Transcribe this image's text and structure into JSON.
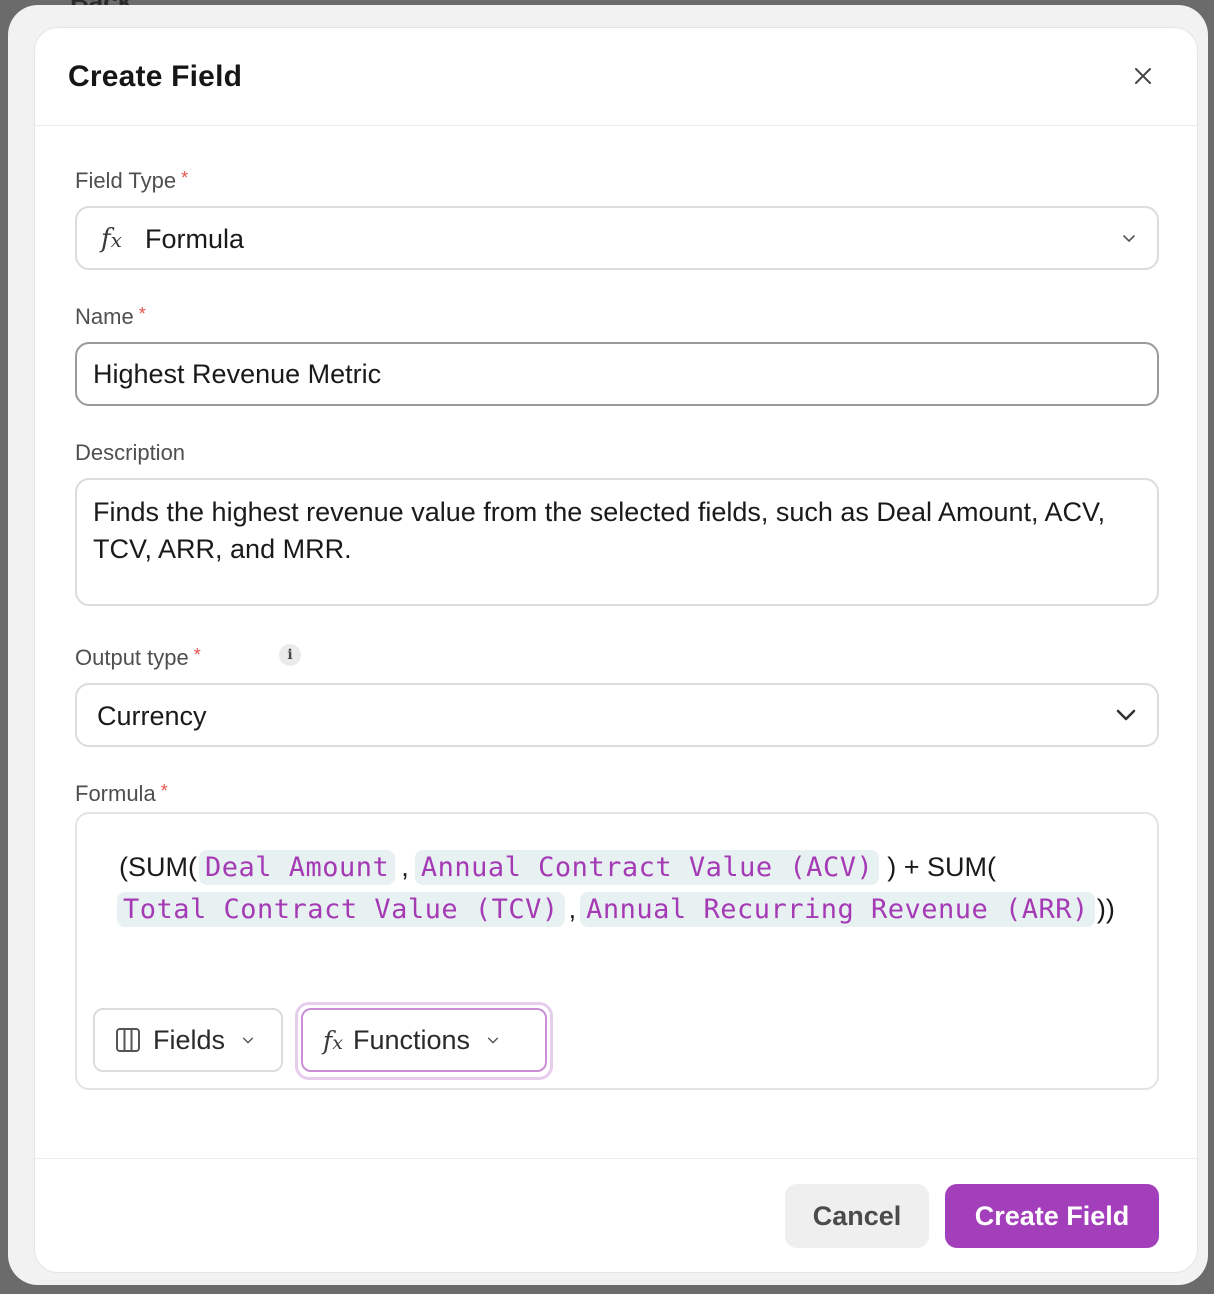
{
  "backdrop": {
    "text": "Back"
  },
  "modal": {
    "title": "Create Field",
    "close_icon": "close-icon"
  },
  "field_type": {
    "label": "Field Type",
    "required": "*",
    "icon": "fx-icon",
    "value": "Formula"
  },
  "name": {
    "label": "Name",
    "required": "*",
    "value": "Highest Revenue Metric"
  },
  "description": {
    "label": "Description",
    "value": "Finds the highest revenue value from the selected fields, such as Deal Amount, ACV, TCV, ARR, and MRR."
  },
  "output_type": {
    "label": "Output type",
    "required": "*",
    "info_icon": "i",
    "value": "Currency"
  },
  "formula": {
    "label": "Formula",
    "required": "*",
    "line1": {
      "open": "(SUM(",
      "token1": "Deal Amount",
      "comma1": ",",
      "token2": "Annual Contract Value (ACV)",
      "mid": ") + SUM("
    },
    "line2": {
      "token3": "Total Contract Value (TCV)",
      "comma2": ",",
      "token4": "Annual Recurring Revenue (ARR)",
      "close": "))"
    },
    "fields_button": "Fields",
    "functions_button": "Functions"
  },
  "footer": {
    "cancel": "Cancel",
    "create": "Create Field"
  },
  "colors": {
    "accent": "#a33fba",
    "token_text": "#a53ab5",
    "token_bg": "#e8f1f2",
    "required": "#e0544d"
  }
}
